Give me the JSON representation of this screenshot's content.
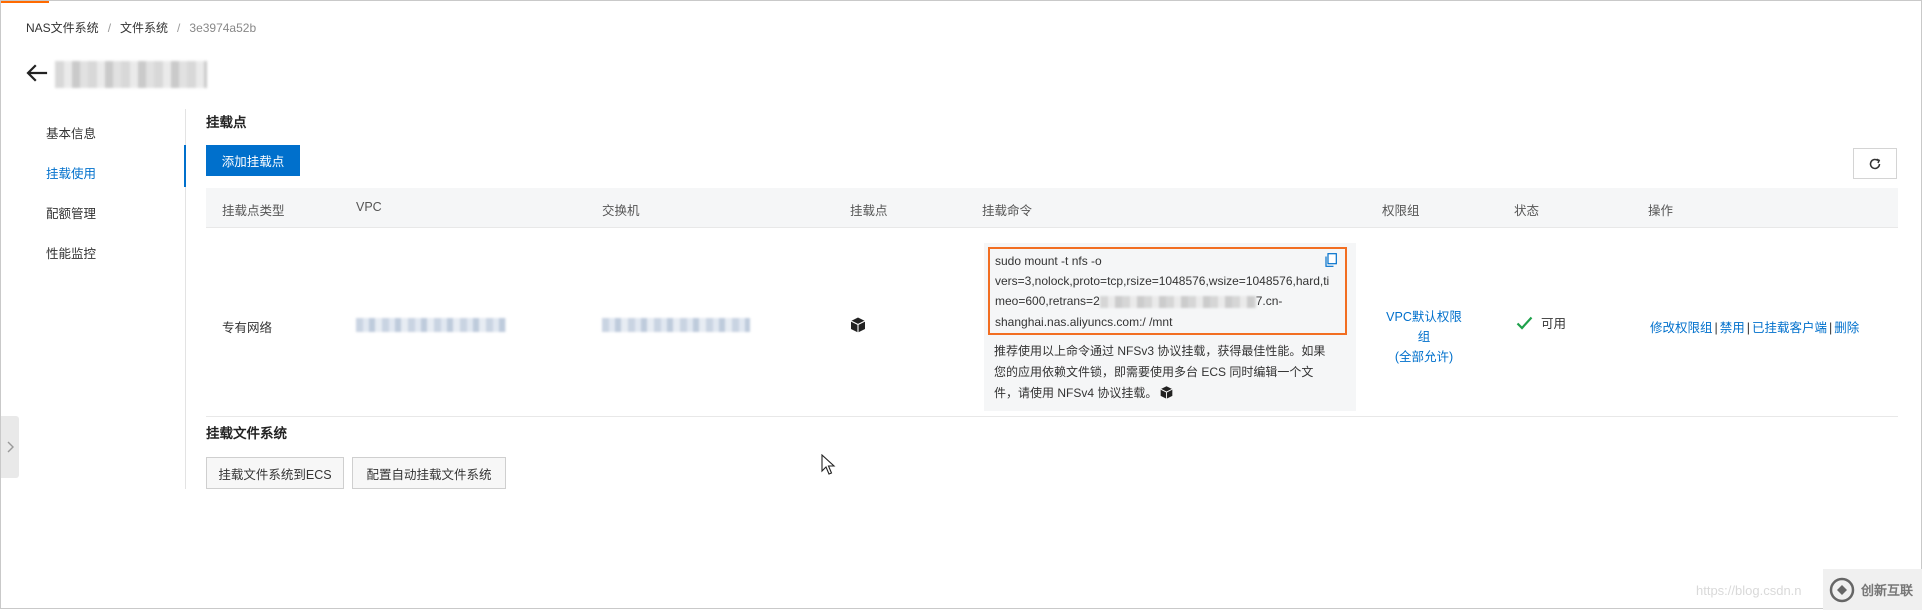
{
  "breadcrumb": {
    "items": [
      "NAS文件系统",
      "文件系统",
      "3e3974a52b"
    ],
    "separator": "/"
  },
  "menu": {
    "items": [
      {
        "label": "基本信息"
      },
      {
        "label": "挂载使用"
      },
      {
        "label": "配额管理"
      },
      {
        "label": "性能监控"
      }
    ],
    "active_label": "挂载使用"
  },
  "mount_section": {
    "title": "挂载点",
    "add_button_label": "添加挂载点"
  },
  "table": {
    "columns": [
      "挂载点类型",
      "VPC",
      "交换机",
      "挂载点",
      "挂载命令",
      "权限组",
      "状态",
      "操作"
    ],
    "row": {
      "type": "专有网络",
      "command": {
        "line1": "sudo mount -t nfs -o",
        "line2": "vers=3,nolock,proto=tcp,rsize=1048576,wsize=1048576,hard,ti",
        "line3_prefix": "meo=600,retrans=2",
        "line3_suffix": "7.cn-",
        "line4": "shanghai.nas.aliyuncs.com:/ /mnt",
        "tip": "推荐使用以上命令通过 NFSv3 协议挂载，获得最佳性能。如果您的应用依赖文件锁，即需要使用多台 ECS 同时编辑一个文件，请使用 NFSv4 协议挂载。"
      },
      "permission_group": {
        "name": "VPC默认权限组",
        "note": "(全部允许)"
      },
      "status": "可用",
      "actions": [
        "修改权限组",
        "禁用",
        "已挂载客户端",
        "删除"
      ]
    }
  },
  "mount_fs_section": {
    "title": "挂载文件系统",
    "button1_label": "挂载文件系统到ECS",
    "button2_label": "配置自动挂载文件系统"
  },
  "watermark": {
    "url": "https://blog.csdn.n",
    "logo_text": "创新互联"
  },
  "colors": {
    "primary": "#0070cc",
    "highlight": "#f26e22",
    "success": "#1fa14b"
  },
  "icons": [
    "arrow-left-icon",
    "refresh-icon",
    "cube-icon",
    "copy-icon",
    "check-icon",
    "chevron-right-icon",
    "mouse-cursor-icon"
  ]
}
